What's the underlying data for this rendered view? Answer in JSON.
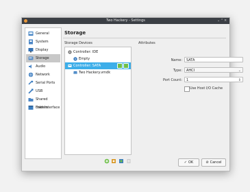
{
  "window": {
    "title": "Two Hackery - Settings"
  },
  "sidebar": {
    "items": [
      {
        "label": "General",
        "icon": "general-icon"
      },
      {
        "label": "System",
        "icon": "system-icon"
      },
      {
        "label": "Display",
        "icon": "display-icon"
      },
      {
        "label": "Storage",
        "icon": "storage-icon",
        "selected": true
      },
      {
        "label": "Audio",
        "icon": "audio-icon"
      },
      {
        "label": "Network",
        "icon": "network-icon"
      },
      {
        "label": "Serial Ports",
        "icon": "serial-ports-icon"
      },
      {
        "label": "USB",
        "icon": "usb-icon"
      },
      {
        "label": "Shared Folders",
        "icon": "shared-folders-icon"
      },
      {
        "label": "User Interface",
        "icon": "user-interface-icon"
      }
    ]
  },
  "main": {
    "heading": "Storage",
    "storage_devices_label": "Storage Devices",
    "attributes_label": "Attributes",
    "tree": [
      {
        "label": "Controller: IDE",
        "level": 0
      },
      {
        "label": "Empty",
        "level": 1
      },
      {
        "label": "Controller: SATA",
        "level": 0,
        "selected": true
      },
      {
        "label": "Two Hackery.vmdk",
        "level": 1
      }
    ],
    "attributes": {
      "name_label": "Name:",
      "name_value": "SATA",
      "type_label": "Type:",
      "type_value": "AHCI",
      "port_count_label": "Port Count:",
      "port_count_value": "1",
      "host_cache_label": "Use Host I/O Cache"
    }
  },
  "buttons": {
    "ok": "OK",
    "cancel": "Cancel"
  },
  "colors": {
    "accent": "#3daee9",
    "titlebar": "#3b3f45",
    "add_green": "#6fbf4a"
  }
}
